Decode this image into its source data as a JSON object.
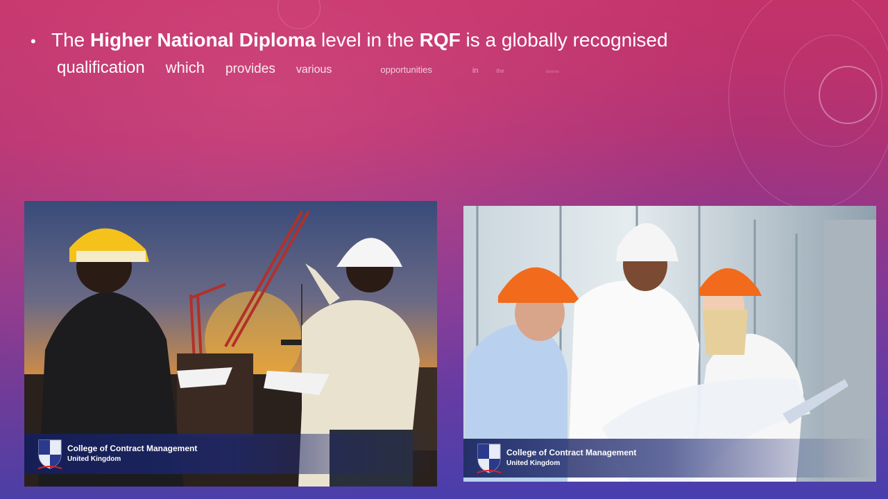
{
  "slide": {
    "bullet": "•",
    "line1": {
      "w1": "The",
      "b1": "Higher National Diploma",
      "w2": "level in the",
      "b2": "RQF",
      "w3": "is a globally recognised"
    },
    "line2": [
      "qualification",
      "which",
      "provides",
      "various",
      "opportunities",
      "in",
      "the",
      "diverse"
    ]
  },
  "photos": [
    {
      "banner_title": "College of Contract Management",
      "banner_sub": "United Kingdom"
    },
    {
      "banner_title": "College of Contract Management",
      "banner_sub": "United Kingdom"
    }
  ],
  "colors": {
    "banner_navy": "#1e2a6e",
    "helmet_yellow": "#f4c21b",
    "helmet_orange": "#f26a1b",
    "helmet_white": "#f5f5f5"
  }
}
